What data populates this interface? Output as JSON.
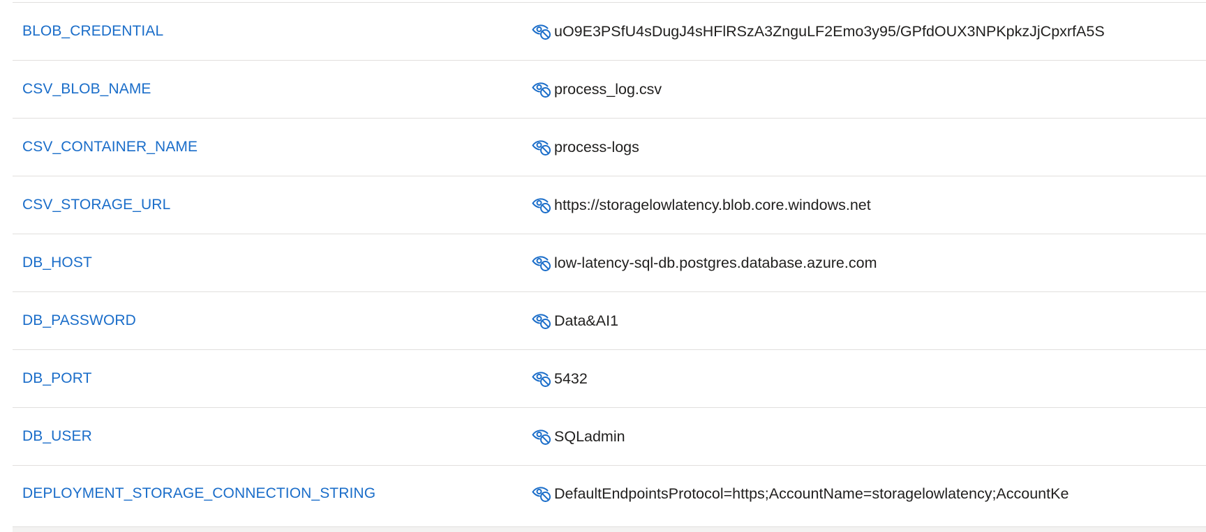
{
  "settings": [
    {
      "name": "BLOB_CREDENTIAL",
      "value": "uO9E3PSfU4sDugJ4sHFlRSzA3ZnguLF2Emo3y95/GPfdOUX3NPKpkzJjCpxrfA5S",
      "icon": "eye-show-value-icon"
    },
    {
      "name": "CSV_BLOB_NAME",
      "value": "process_log.csv",
      "icon": "eye-show-value-icon"
    },
    {
      "name": "CSV_CONTAINER_NAME",
      "value": "process-logs",
      "icon": "eye-show-value-icon"
    },
    {
      "name": "CSV_STORAGE_URL",
      "value": "https://storagelowlatency.blob.core.windows.net",
      "icon": "eye-show-value-icon"
    },
    {
      "name": "DB_HOST",
      "value": "low-latency-sql-db.postgres.database.azure.com",
      "icon": "eye-show-value-icon"
    },
    {
      "name": "DB_PASSWORD",
      "value": "Data&AI1",
      "icon": "eye-show-value-icon"
    },
    {
      "name": "DB_PORT",
      "value": "5432",
      "icon": "eye-show-value-icon"
    },
    {
      "name": "DB_USER",
      "value": "SQLadmin",
      "icon": "eye-show-value-icon"
    },
    {
      "name": "DEPLOYMENT_STORAGE_CONNECTION_STRING",
      "value": "DefaultEndpointsProtocol=https;AccountName=storagelowlatency;AccountKe",
      "icon": "eye-show-value-icon"
    }
  ],
  "colors": {
    "link": "#1a6dc9",
    "text": "#201f1e",
    "divider": "#e1dfdd",
    "icon": "#1a6dc9"
  }
}
